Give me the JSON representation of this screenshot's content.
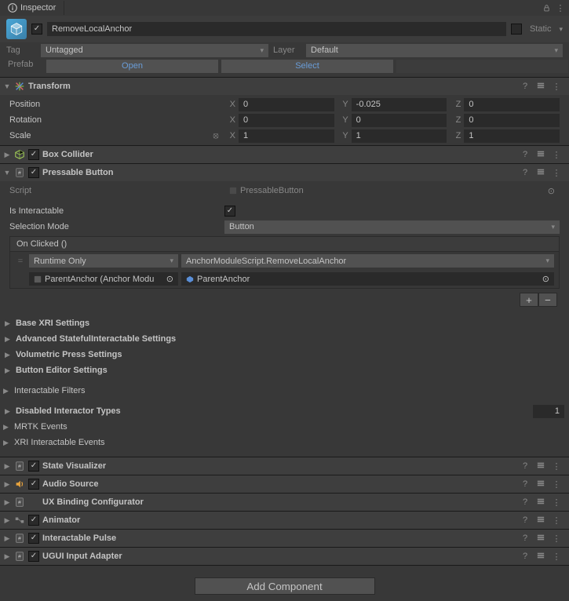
{
  "tab": {
    "title": "Inspector"
  },
  "object": {
    "enabled": true,
    "name": "RemoveLocalAnchor",
    "static_label": "Static",
    "tag_label": "Tag",
    "tag_value": "Untagged",
    "layer_label": "Layer",
    "layer_value": "Default"
  },
  "prefab": {
    "label": "Prefab",
    "open": "Open",
    "select": "Select",
    "overrides": ""
  },
  "transform": {
    "title": "Transform",
    "position": {
      "label": "Position",
      "x": "0",
      "y": "-0.025",
      "z": "0"
    },
    "rotation": {
      "label": "Rotation",
      "x": "0",
      "y": "0",
      "z": "0"
    },
    "scale": {
      "label": "Scale",
      "x": "1",
      "y": "1",
      "z": "1"
    }
  },
  "box_collider": {
    "title": "Box Collider",
    "enabled": true
  },
  "pressable": {
    "title": "Pressable Button",
    "enabled": true,
    "script_label": "Script",
    "script_value": "PressableButton",
    "interactable_label": "Is Interactable",
    "interactable": true,
    "selmode_label": "Selection Mode",
    "selmode_value": "Button",
    "event": {
      "header": "On Clicked ()",
      "runtime": "Runtime Only",
      "function": "AnchorModuleScript.RemoveLocalAnchor",
      "target": "ParentAnchor (Anchor Modu",
      "arg": "ParentAnchor"
    }
  },
  "sections": {
    "base_xri": "Base XRI Settings",
    "adv_stateful": "Advanced StatefulInteractable Settings",
    "vol_press": "Volumetric Press Settings",
    "btn_editor": "Button Editor Settings",
    "inter_filters": "Interactable Filters",
    "disabled_types": "Disabled Interactor Types",
    "disabled_count": "1",
    "mrtk_events": "MRTK Events",
    "xri_events": "XRI Interactable Events"
  },
  "components": {
    "state_vis": {
      "title": "State Visualizer",
      "enabled": true
    },
    "audio": {
      "title": "Audio Source",
      "enabled": true
    },
    "ux_binding": {
      "title": "UX Binding Configurator"
    },
    "animator": {
      "title": "Animator",
      "enabled": true
    },
    "pulse": {
      "title": "Interactable Pulse",
      "enabled": true
    },
    "ugui": {
      "title": "UGUI Input Adapter",
      "enabled": true
    }
  },
  "add_component": "Add Component",
  "axes": {
    "x": "X",
    "y": "Y",
    "z": "Z"
  }
}
